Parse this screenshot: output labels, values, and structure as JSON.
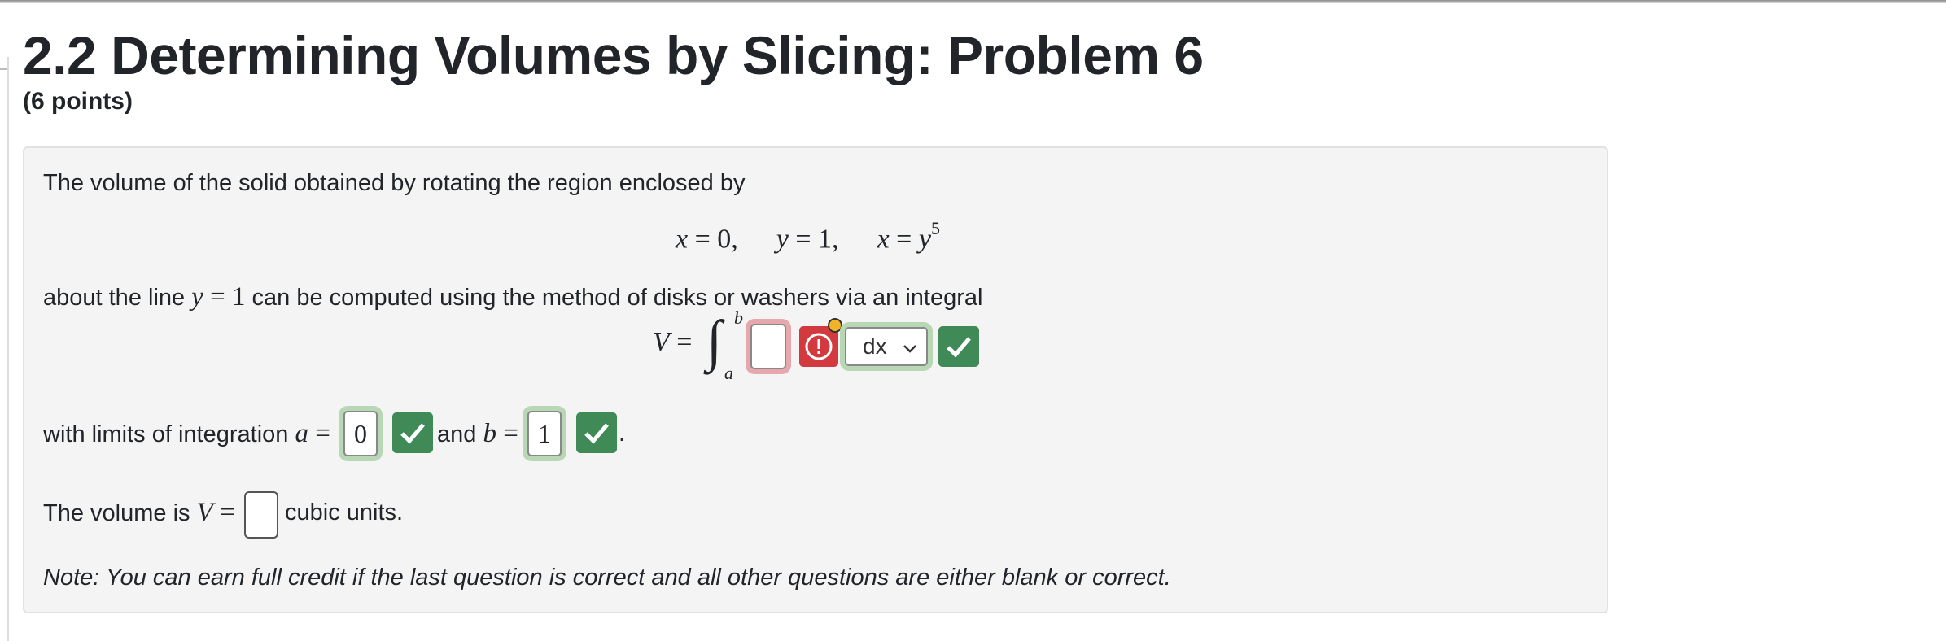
{
  "page": {
    "title": "2.2 Determining Volumes by Slicing: Problem 6",
    "points": "(6 points)"
  },
  "problem": {
    "intro": "The volume of the solid obtained by rotating the region enclosed by",
    "eq_x0_var": "x",
    "eq_x0_rest": " = 0,",
    "eq_y1_var": "y",
    "eq_y1_rest": " = 1,",
    "eq_xy_var": "x",
    "eq_xy_eq": " = ",
    "eq_xy_rhs": "y",
    "eq_xy_exp": "5",
    "about_prefix": "about the line ",
    "about_var": "y",
    "about_eq": " = 1",
    "about_suffix": " can be computed using the method of disks or washers via an integral",
    "integral_V": "V",
    "integral_eq": " =",
    "integral_sign": "∫",
    "upper_limit": "b",
    "lower_limit": "a",
    "integrand_value": "",
    "differential_selected": "dx",
    "limits_prefix": "with limits of integration ",
    "limit_a_var": "a",
    "limit_a_eq": " =",
    "limit_a_value": "0",
    "and_text": " and ",
    "limit_b_var": "b",
    "limit_b_eq": " =",
    "limit_b_value": "1",
    "period": ".",
    "volume_prefix": "The volume is ",
    "volume_var": "V",
    "volume_eq": " =",
    "volume_value": "",
    "volume_suffix": "cubic units.",
    "note": "Note: You can earn full credit if the last question is correct and all other questions are either blank or correct."
  },
  "icons": {
    "correct": "check-icon",
    "incorrect": "exclamation-circle-icon",
    "dropdown": "chevron-down-icon"
  },
  "colors": {
    "correct_bg": "#3f8a57",
    "correct_ring": "#b7d7b5",
    "incorrect_bg": "#d23a3f",
    "incorrect_ring": "#e6a8ad",
    "focus_dot": "#f0b429"
  }
}
